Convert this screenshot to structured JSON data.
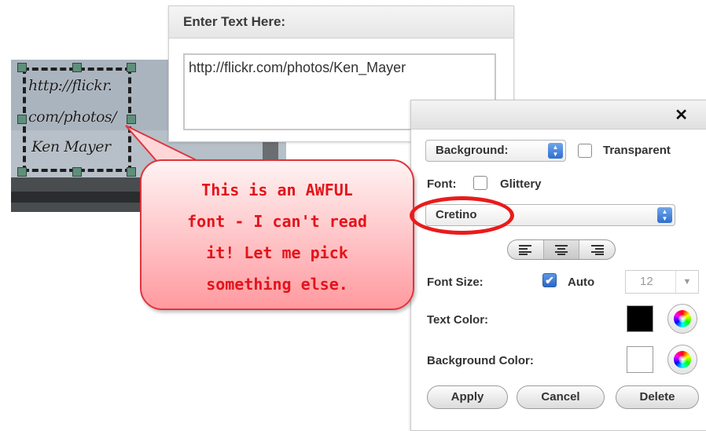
{
  "text_dialog": {
    "title": "Enter Text Here:",
    "text_value": "http://flickr.com/photos/Ken_Mayer"
  },
  "photo": {
    "text_lines": [
      "http://flickr.",
      "com/photos/",
      "Ken Mayer"
    ]
  },
  "panel": {
    "close_icon": "close-icon",
    "background_select": "Background:",
    "transparent_label": "Transparent",
    "font_label": "Font:",
    "glittery_label": "Glittery",
    "font_select": "Cretino",
    "alignment_icons": [
      "align-left-icon",
      "align-center-icon",
      "align-right-icon"
    ],
    "font_size_label": "Font Size:",
    "auto_label": "Auto",
    "font_size_value": "12",
    "text_color_label": "Text Color:",
    "text_color": "#000000",
    "background_color_label": "Background Color:",
    "background_color": "#ffffff",
    "apply_label": "Apply",
    "cancel_label": "Cancel",
    "delete_label": "Delete"
  },
  "annotation": {
    "lines": [
      "This is an AWFUL",
      "font - I can't read",
      "it! Let me pick",
      "something else."
    ],
    "color": "#e3141b"
  }
}
